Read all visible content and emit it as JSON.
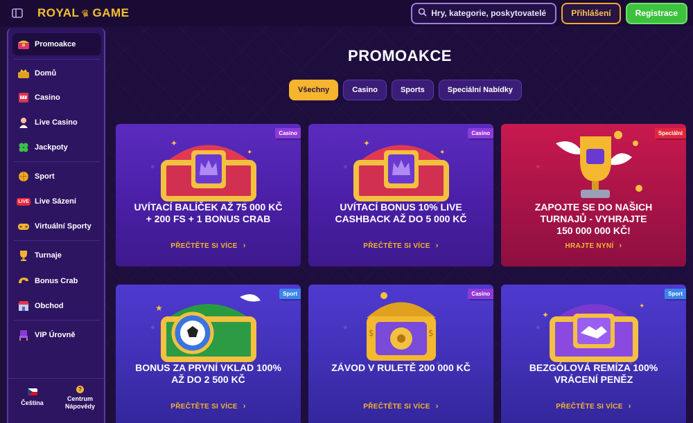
{
  "header": {
    "logo_left": "ROYAL",
    "logo_right": "GAME",
    "search_placeholder": "Hry, kategorie, poskytovatelé",
    "login_label": "Přihlášení",
    "register_label": "Registrace",
    "colors": {
      "accent": "#f5b52e",
      "register": "#3ec23e",
      "background": "#1e0e3e"
    }
  },
  "sidebar": {
    "items": [
      {
        "label": "Promoakce",
        "icon": "treasure-chest-icon"
      },
      {
        "label": "Domů",
        "icon": "crown-chest-icon"
      },
      {
        "label": "Casino",
        "icon": "slot-machine-icon"
      },
      {
        "label": "Live Casino",
        "icon": "dealer-icon"
      },
      {
        "label": "Jackpoty",
        "icon": "clover-icon"
      },
      {
        "label": "Sport",
        "icon": "ball-icon"
      },
      {
        "label": "Live Sázení",
        "icon": "live-badge-icon",
        "badge": "LIVE"
      },
      {
        "label": "Virtuální Sporty",
        "icon": "gamepad-icon"
      },
      {
        "label": "Turnaje",
        "icon": "trophy-icon"
      },
      {
        "label": "Bonus Crab",
        "icon": "claw-icon"
      },
      {
        "label": "Obchod",
        "icon": "shop-icon"
      },
      {
        "label": "VIP Úrovně",
        "icon": "vip-chair-icon"
      }
    ],
    "language_label": "Čeština",
    "help_label_1": "Centrum",
    "help_label_2": "Nápovědy"
  },
  "main": {
    "title": "PROMOAKCE",
    "filters": [
      {
        "label": "Všechny",
        "active": true
      },
      {
        "label": "Casino",
        "active": false
      },
      {
        "label": "Sports",
        "active": false
      },
      {
        "label": "Speciální Nabídky",
        "active": false
      }
    ],
    "cards": [
      {
        "tag": "Casino",
        "title_1": "UVÍTACÍ BALÍČEK AŽ 75 000 KČ",
        "title_2": "+ 200 FS + 1 BONUS CRAB",
        "title_3": "",
        "link": "PŘEČTĚTE SI VÍCE",
        "art": "crown-chest-icon"
      },
      {
        "tag": "Casino",
        "title_1": "UVÍTACÍ BONUS 10% LIVE",
        "title_2": "CASHBACK AŽ DO 5 000 KČ",
        "title_3": "",
        "link": "PŘEČTĚTE SI VÍCE",
        "art": "crown-chest-icon"
      },
      {
        "tag": "Speciální",
        "title_1": "ZAPOJTE SE DO NAŠICH",
        "title_2": "TURNAJŮ - VYHRAJTE",
        "title_3": "150 000 000 KČ!",
        "link": "HRAJTE NYNÍ",
        "art": "winged-trophy-icon"
      },
      {
        "tag": "Sport",
        "title_1": "BONUS ZA PRVNÍ VKLAD 100%",
        "title_2": "AŽ DO 2 500 KČ",
        "title_3": "",
        "link": "PŘEČTĚTE SI VÍCE",
        "art": "football-chest-icon"
      },
      {
        "tag": "Casino",
        "title_1": "ZÁVOD V RULETĚ 200 000 KČ",
        "title_2": "",
        "title_3": "",
        "link": "PŘEČTĚTE SI VÍCE",
        "art": "safe-chest-icon"
      },
      {
        "tag": "Sport",
        "title_1": "BEZGÓLOVÁ REMÍZA 100%",
        "title_2": "VRÁCENÍ PENĚZ",
        "title_3": "",
        "link": "PŘEČTĚTE SI VÍCE",
        "art": "handshake-chest-icon"
      }
    ]
  }
}
